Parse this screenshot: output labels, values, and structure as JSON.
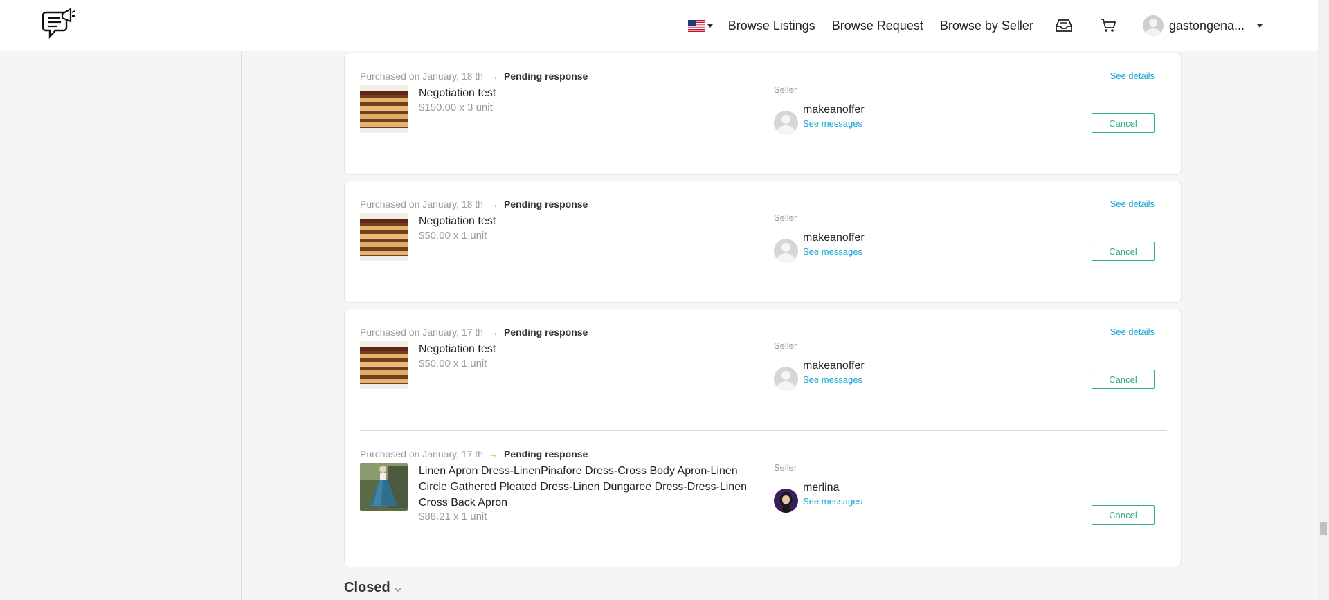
{
  "header": {
    "nav": [
      "Browse Listings",
      "Browse Request",
      "Browse by Seller"
    ],
    "username": "gastongena..."
  },
  "orders": [
    {
      "date_text": "Purchased on January, 18 th",
      "status": "Pending response",
      "details_label": "See details",
      "title": "Negotiation test",
      "price": "$150.00 x 3 unit",
      "seller_label": "Seller",
      "seller": "makeanoffer",
      "messages_label": "See messages",
      "cancel_label": "Cancel",
      "image": "cake"
    },
    {
      "date_text": "Purchased on January, 18 th",
      "status": "Pending response",
      "details_label": "See details",
      "title": "Negotiation test",
      "price": "$50.00 x 1 unit",
      "seller_label": "Seller",
      "seller": "makeanoffer",
      "messages_label": "See messages",
      "cancel_label": "Cancel",
      "image": "cake"
    },
    {
      "date_text": "Purchased on January, 17 th",
      "status": "Pending response",
      "details_label": "See details",
      "title": "Negotiation test",
      "price": "$50.00 x 1 unit",
      "seller_label": "Seller",
      "seller": "makeanoffer",
      "messages_label": "See messages",
      "cancel_label": "Cancel",
      "image": "cake"
    },
    {
      "date_text": "Purchased on January, 17 th",
      "status": "Pending response",
      "title": "Linen Apron Dress-LinenPinafore Dress-Cross Body Apron-Linen Circle Gathered Pleated Dress-Linen Dungaree Dress-Dress-Linen Cross Back Apron",
      "price": "$88.21 x 1 unit",
      "seller_label": "Seller",
      "seller": "merlina",
      "messages_label": "See messages",
      "cancel_label": "Cancel",
      "image": "dress"
    }
  ],
  "closed_label": "Closed",
  "colors": {
    "accent_link": "#1aa6d6",
    "cancel_green": "#2eae86",
    "arrow_orange": "#f0a020"
  }
}
